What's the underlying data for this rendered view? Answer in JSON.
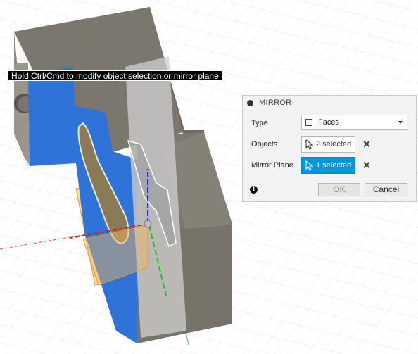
{
  "tooltip": {
    "text": "Hold Ctrl/Cmd to modify object selection or mirror plane"
  },
  "dialog": {
    "title": "MIRROR",
    "type": {
      "label": "Type",
      "value": "Faces",
      "icon": "faces-icon"
    },
    "objects": {
      "label": "Objects",
      "value": "2 selected"
    },
    "mirror_plane": {
      "label": "Mirror Plane",
      "value": "1 selected"
    },
    "ok_label": "OK",
    "cancel_label": "Cancel"
  },
  "colors": {
    "active_selection": "#0696d7",
    "model_gray": "#7d786f",
    "selected_face_blue": "#2a6fd6",
    "mirror_plane_orange": "#f5b85a",
    "axis_red": "#e03030",
    "axis_blue": "#1530d0",
    "axis_green": "#30c030"
  }
}
